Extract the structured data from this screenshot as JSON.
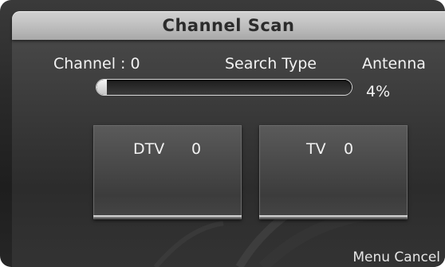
{
  "dialog": {
    "title": "Channel Scan"
  },
  "scan": {
    "channel_label": "Channel : 0",
    "search_type_label": "Search Type",
    "search_type_value": "Antenna",
    "progress_text": "4%",
    "progress_fraction": 0.04
  },
  "results": {
    "dtv_label": "DTV",
    "dtv_count": "0",
    "tv_label": "TV",
    "tv_count": "0"
  },
  "footer": {
    "menu_label": "Menu",
    "cancel_label": "Cancel"
  },
  "colors": {
    "title_bar": "#bdbdbd",
    "background": "#2e2e2e",
    "text": "#f2f2f2",
    "title_text": "#2b2b2b"
  }
}
